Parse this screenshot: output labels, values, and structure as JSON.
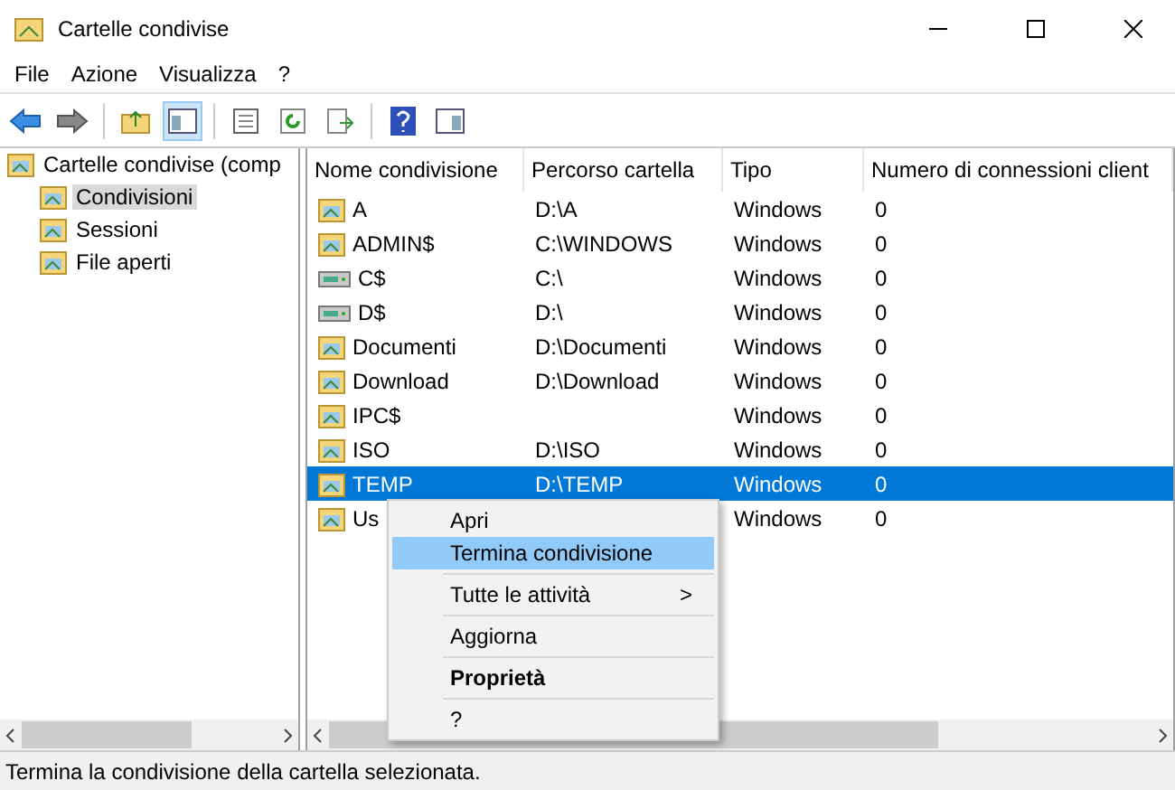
{
  "window": {
    "title": "Cartelle condivise"
  },
  "menu": [
    "File",
    "Azione",
    "Visualizza",
    "?"
  ],
  "tree": {
    "label": "Cartelle condivise (comp",
    "children": [
      {
        "label": "Condivisioni",
        "selected": true
      },
      {
        "label": "Sessioni",
        "selected": false
      },
      {
        "label": "File aperti",
        "selected": false
      }
    ]
  },
  "table": {
    "columns": [
      "Nome condivisione",
      "Percorso cartella",
      "Tipo",
      "Numero di connessioni client"
    ],
    "rows": [
      {
        "kind": "folder",
        "selected": false,
        "cells": [
          "A",
          "D:\\A",
          "Windows",
          "0"
        ]
      },
      {
        "kind": "folder",
        "selected": false,
        "cells": [
          "ADMIN$",
          "C:\\WINDOWS",
          "Windows",
          "0"
        ]
      },
      {
        "kind": "drive",
        "selected": false,
        "cells": [
          "C$",
          "C:\\",
          "Windows",
          "0"
        ]
      },
      {
        "kind": "drive",
        "selected": false,
        "cells": [
          "D$",
          "D:\\",
          "Windows",
          "0"
        ]
      },
      {
        "kind": "folder",
        "selected": false,
        "cells": [
          "Documenti",
          "D:\\Documenti",
          "Windows",
          "0"
        ]
      },
      {
        "kind": "folder",
        "selected": false,
        "cells": [
          "Download",
          "D:\\Download",
          "Windows",
          "0"
        ]
      },
      {
        "kind": "folder",
        "selected": false,
        "cells": [
          "IPC$",
          "",
          "Windows",
          "0"
        ]
      },
      {
        "kind": "folder",
        "selected": false,
        "cells": [
          "ISO",
          "D:\\ISO",
          "Windows",
          "0"
        ]
      },
      {
        "kind": "folder",
        "selected": true,
        "cells": [
          "TEMP",
          "D:\\TEMP",
          "Windows",
          "0"
        ]
      },
      {
        "kind": "folder",
        "selected": false,
        "cells": [
          "Us",
          "",
          "Windows",
          "0"
        ]
      }
    ]
  },
  "context_menu": [
    {
      "kind": "item",
      "label": "Apri",
      "selected": false,
      "bold": false
    },
    {
      "kind": "item",
      "label": "Termina condivisione",
      "selected": true,
      "bold": false
    },
    {
      "kind": "separator"
    },
    {
      "kind": "submenu",
      "label": "Tutte le attività",
      "arrow": ">",
      "selected": false,
      "bold": false
    },
    {
      "kind": "separator"
    },
    {
      "kind": "item",
      "label": "Aggiorna",
      "selected": false,
      "bold": false
    },
    {
      "kind": "separator"
    },
    {
      "kind": "item",
      "label": "Proprietà",
      "selected": false,
      "bold": true
    },
    {
      "kind": "separator"
    },
    {
      "kind": "item",
      "label": "?",
      "selected": false,
      "bold": false
    }
  ],
  "status_bar": "Termina la condivisione della cartella selezionata."
}
